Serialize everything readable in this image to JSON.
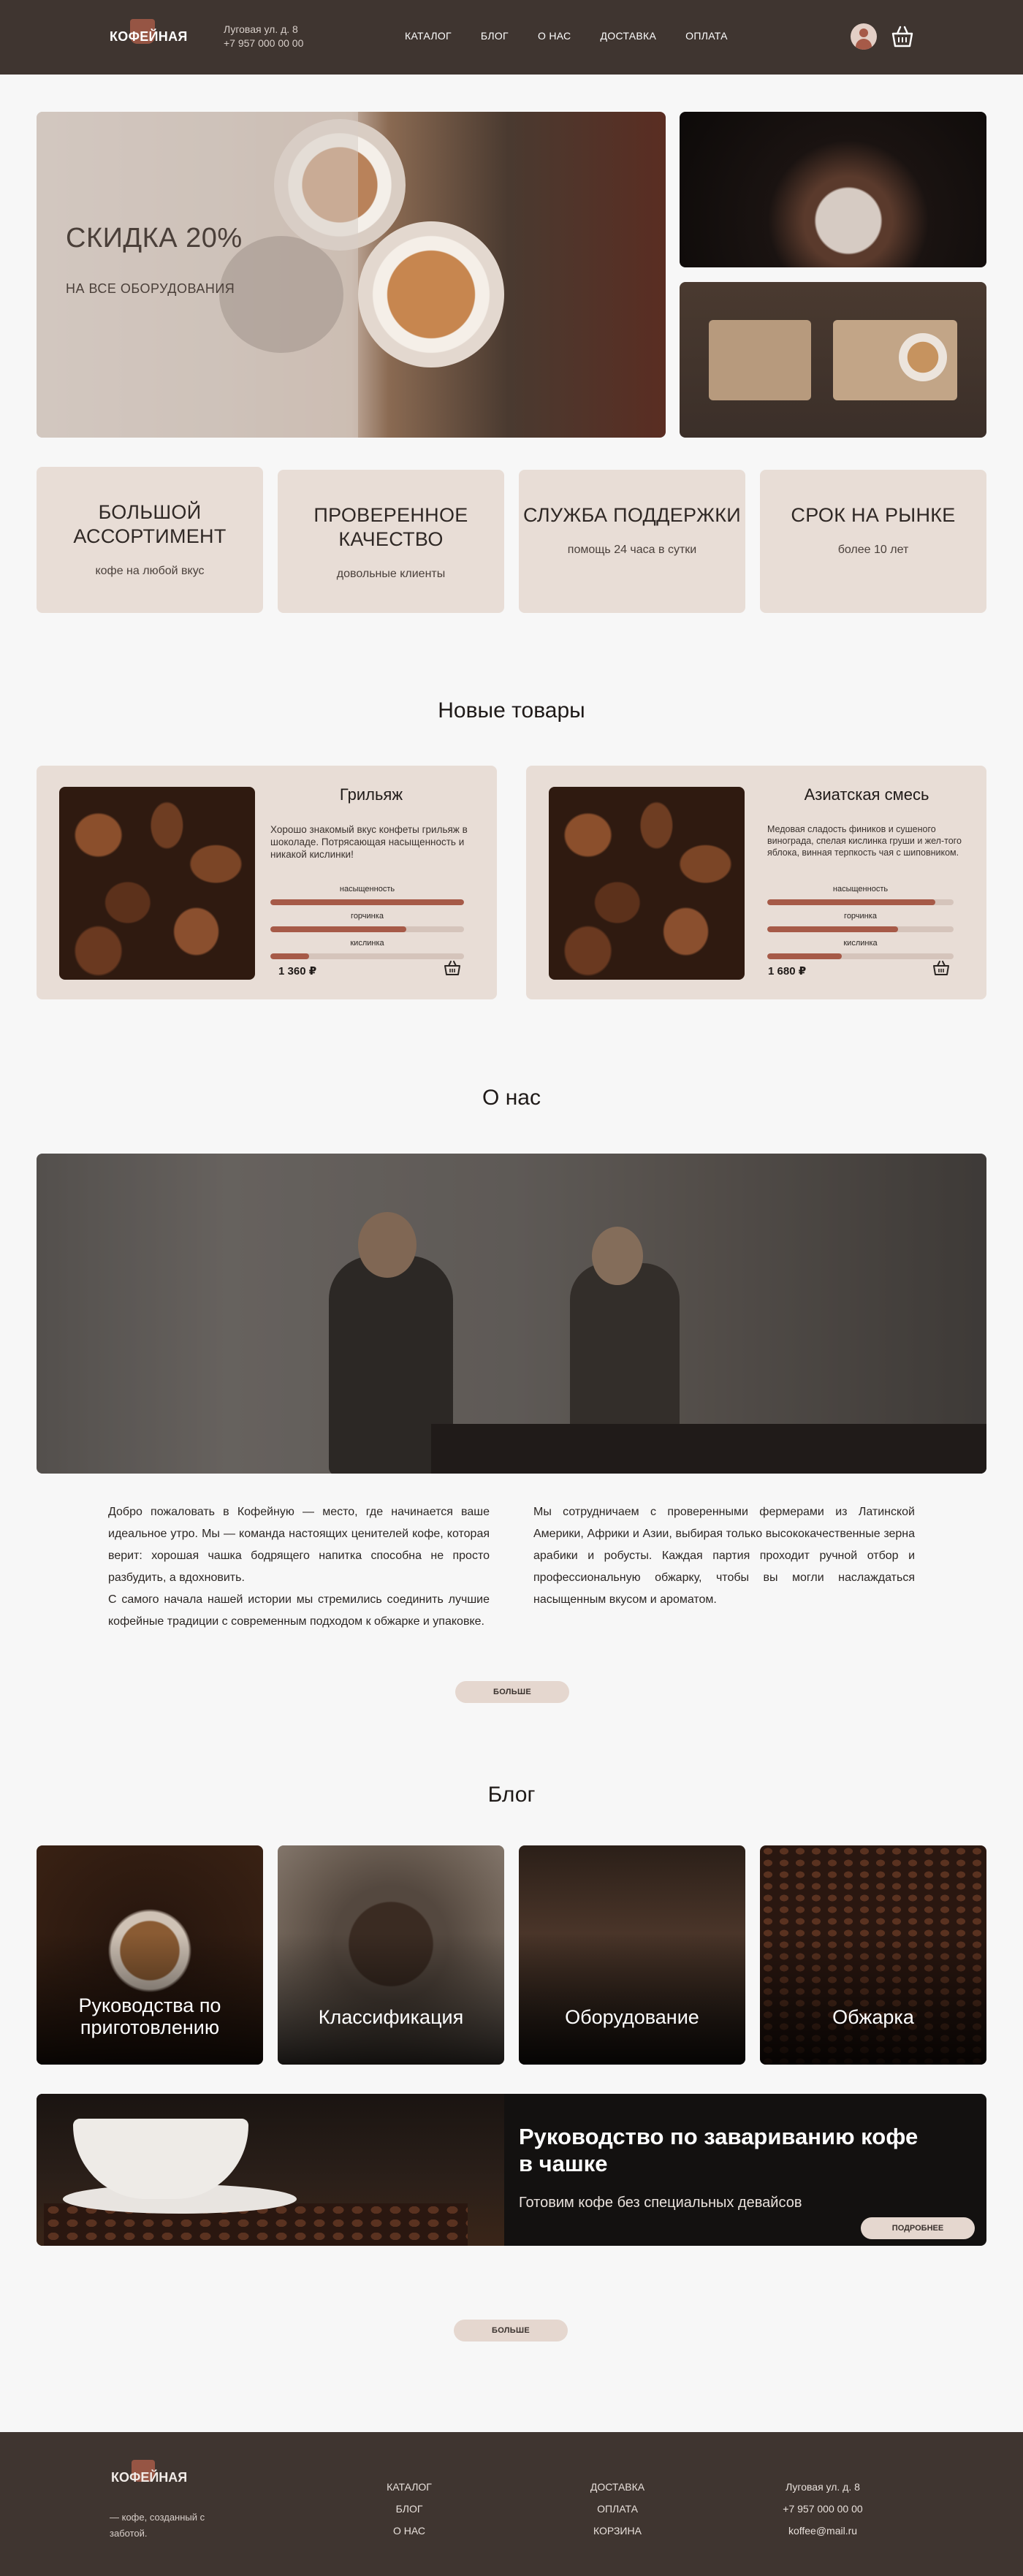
{
  "header": {
    "logo_text": "КОФЕЙНАЯ",
    "address_line1": "Луговая ул. д. 8",
    "address_line2": "+7 957 000 00 00",
    "nav": [
      "КАТАЛОГ",
      "БЛОГ",
      "О НАС",
      "ДОСТАВКА",
      "ОПЛАТА"
    ],
    "icons": [
      "user-icon",
      "basket-icon"
    ]
  },
  "hero": {
    "title": "СКИДКА 20%",
    "subtitle": "НА ВСЕ ОБОРУДОВАНИЯ"
  },
  "features": [
    {
      "title": "БОЛЬШОЙ АССОРТИМЕНТ",
      "text": "кофе на любой вкус"
    },
    {
      "title": "ПРОВЕРЕННОЕ КАЧЕСТВО",
      "text": "довольные клиенты"
    },
    {
      "title": "СЛУЖБА ПОДДЕРЖКИ",
      "text": "помощь 24 часа в сутки"
    },
    {
      "title": "СРОК НА РЫНКЕ",
      "text": "более 10 лет"
    }
  ],
  "new_products": {
    "title": "Новые товары",
    "items": [
      {
        "name": "Грильяж",
        "description": "Хорошо знакомый вкус конфеты грильяж в шоколаде. Потрясающая насыщенность и никакой кислинки!",
        "bars": [
          {
            "label": "насыщенность",
            "level": 1.0
          },
          {
            "label": "горчинка",
            "level": 0.7
          },
          {
            "label": "кислинка",
            "level": 0.2
          }
        ],
        "price": "1 360 ₽"
      },
      {
        "name": "Азиатская смесь",
        "description": "Медовая сладость фиников и сушеного винограда, спелая кислинка груши и жел-того яблока, винная терпкость чая с шиповником.",
        "bars": [
          {
            "label": "насыщенность",
            "level": 0.9
          },
          {
            "label": "горчинка",
            "level": 0.7
          },
          {
            "label": "кислинка",
            "level": 0.4
          }
        ],
        "price": "1 680 ₽"
      }
    ]
  },
  "about": {
    "title": "О нас",
    "col1_p1": "Добро пожаловать в Кофейную — место, где начинается ваше идеальное утро. Мы — команда настоящих ценителей кофе, которая верит: хорошая чашка бодрящего напитка способна не просто разбудить, а вдохновить.",
    "col1_p2": "С самого начала нашей истории мы стремились соединить лучшие кофейные традиции с современным подходом к обжарке и упаковке.",
    "col2": "Мы сотрудничаем с проверенными фермерами из Латинской Америки, Африки и Азии, выбирая только высококачественные зерна арабики и робусты. Каждая партия проходит ручной отбор и профессиональную обжарку, чтобы вы могли наслаждаться насыщенным вкусом и ароматом.",
    "more_label": "БОЛЬШЕ"
  },
  "blog": {
    "title": "Блог",
    "cards": [
      "Руководства по приготовлению",
      "Классификация",
      "Оборудование",
      "Обжарка"
    ],
    "banner_title": "Руководство по завариванию кофе в чашке",
    "banner_subtitle": "Готовим кофе без специальных девайсов",
    "banner_button": "ПОДРОБНЕЕ",
    "more_label": "БОЛЬШЕ"
  },
  "footer": {
    "logo_text": "КОФЕЙНАЯ",
    "tagline": "— кофе, созданный с заботой.",
    "col1": [
      "КАТАЛОГ",
      "БЛОГ",
      "О НАС"
    ],
    "col2": [
      "ДОСТАВКА",
      "ОПЛАТА",
      "КОРЗИНА"
    ],
    "contacts": [
      "Луговая ул. д. 8",
      "+7 957 000 00 00",
      "koffee@mail.ru"
    ]
  },
  "colors": {
    "header_bg": "#3f3530",
    "accent": "#a65a48",
    "card_bg": "#e8ddd6",
    "page_bg": "#f7f7f7"
  }
}
